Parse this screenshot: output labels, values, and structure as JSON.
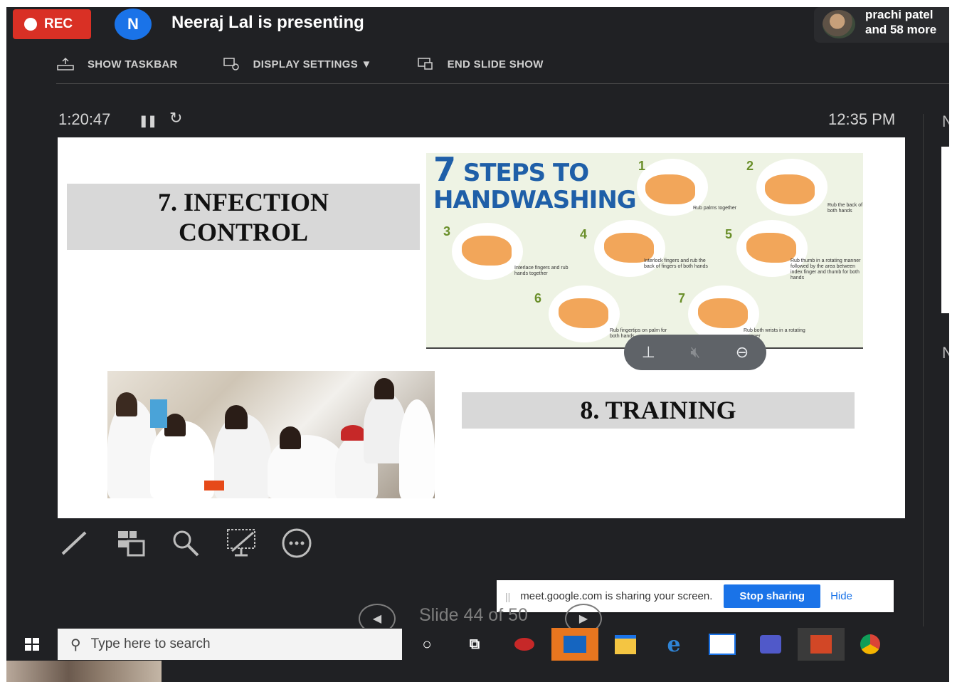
{
  "meeting": {
    "rec_label": "REC",
    "presenter_initial": "N",
    "presenting_text": "Neeraj Lal is presenting",
    "participants_line1": "prachi patel",
    "participants_line2": "and 58 more"
  },
  "ppt_toolbar": {
    "show_taskbar": "SHOW TASKBAR",
    "display_settings": "DISPLAY SETTINGS ▼",
    "end_slide_show": "END SLIDE SHOW"
  },
  "presenter_view": {
    "elapsed": "1:20:47",
    "clock": "12:35 PM",
    "slide_counter_prefix": "Slide 44",
    "slide_counter_suffix": " of 50"
  },
  "slide": {
    "infection_line1": "7. INFECTION",
    "infection_line2": "CONTROL",
    "training": "8. TRAINING",
    "poster_title_num": "7",
    "poster_title_line1": " STEPS TO",
    "poster_title_line2": "HANDWASHING",
    "steps": [
      "1",
      "2",
      "3",
      "4",
      "5",
      "6",
      "7"
    ],
    "step_captions": [
      "Rub palms together",
      "Rub the back of both hands",
      "Interlace fingers and rub hands together",
      "Interlock fingers and rub the back of fingers of both hands",
      "Rub thumb in a rotating manner followed by the area between index finger and thumb for both hands",
      "Rub fingertips on palm for both hands",
      "Rub both wrists in a rotating manner"
    ]
  },
  "share_bar": {
    "message": "meet.google.com is sharing your screen.",
    "stop": "Stop sharing",
    "hide": "Hide"
  },
  "taskbar": {
    "search_placeholder": "Type here to search"
  },
  "colors": {
    "rec_red": "#d93025",
    "google_blue": "#1a73e8",
    "dark_bg": "#202124"
  }
}
